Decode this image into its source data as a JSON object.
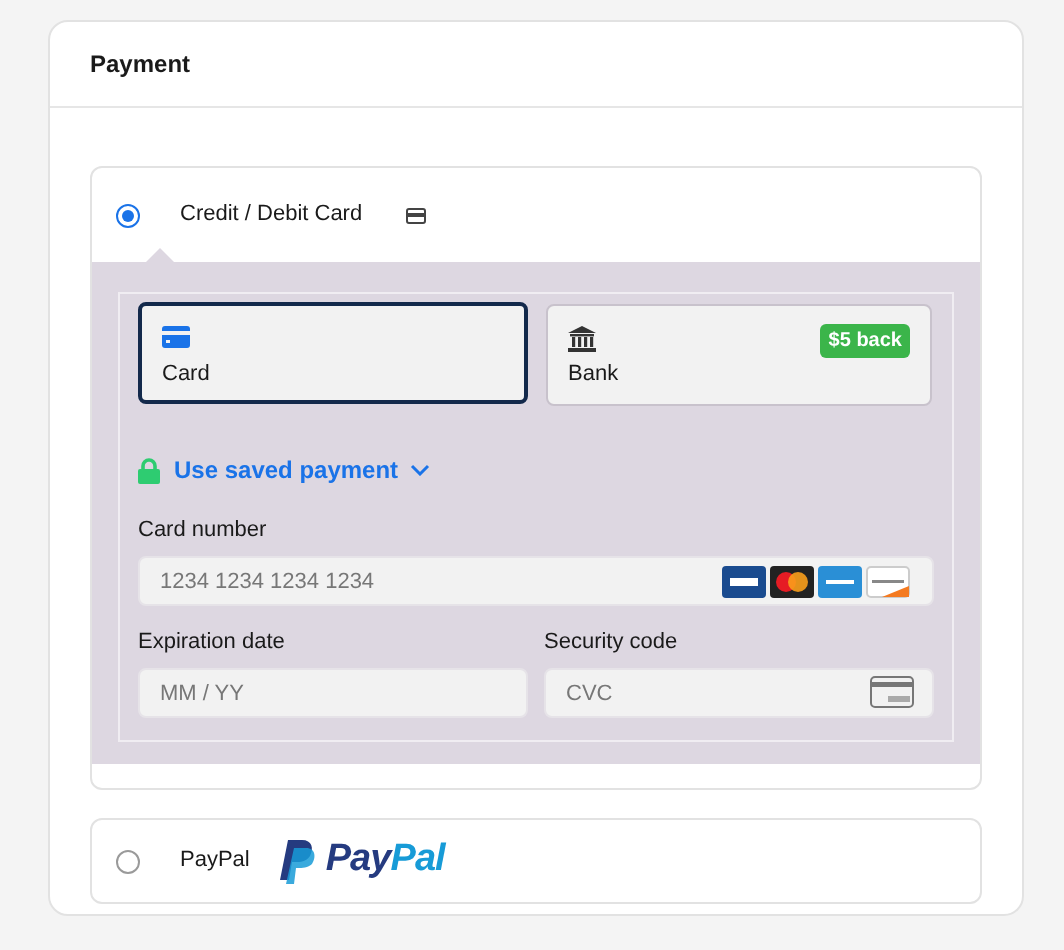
{
  "title": "Payment",
  "methods": [
    {
      "kind": "card",
      "label": "Credit / Debit Card",
      "selected": true
    },
    {
      "kind": "paypal",
      "label": "PayPal",
      "selected": false,
      "logo_words": [
        "Pay",
        "Pal"
      ]
    }
  ],
  "card_form": {
    "tabs": [
      {
        "kind": "card",
        "label": "Card",
        "selected": true
      },
      {
        "kind": "bank",
        "label": "Bank",
        "selected": false,
        "badge": "$5 back"
      }
    ],
    "saved_payment_link": "Use saved payment",
    "fields": [
      {
        "kind": "brands",
        "label": "Card number",
        "placeholder": "1234 1234 1234 1234"
      },
      {
        "kind": "plain",
        "label": "Expiration date",
        "placeholder": "MM / YY"
      },
      {
        "kind": "cvc",
        "label": "Security code",
        "placeholder": "CVC"
      }
    ]
  }
}
